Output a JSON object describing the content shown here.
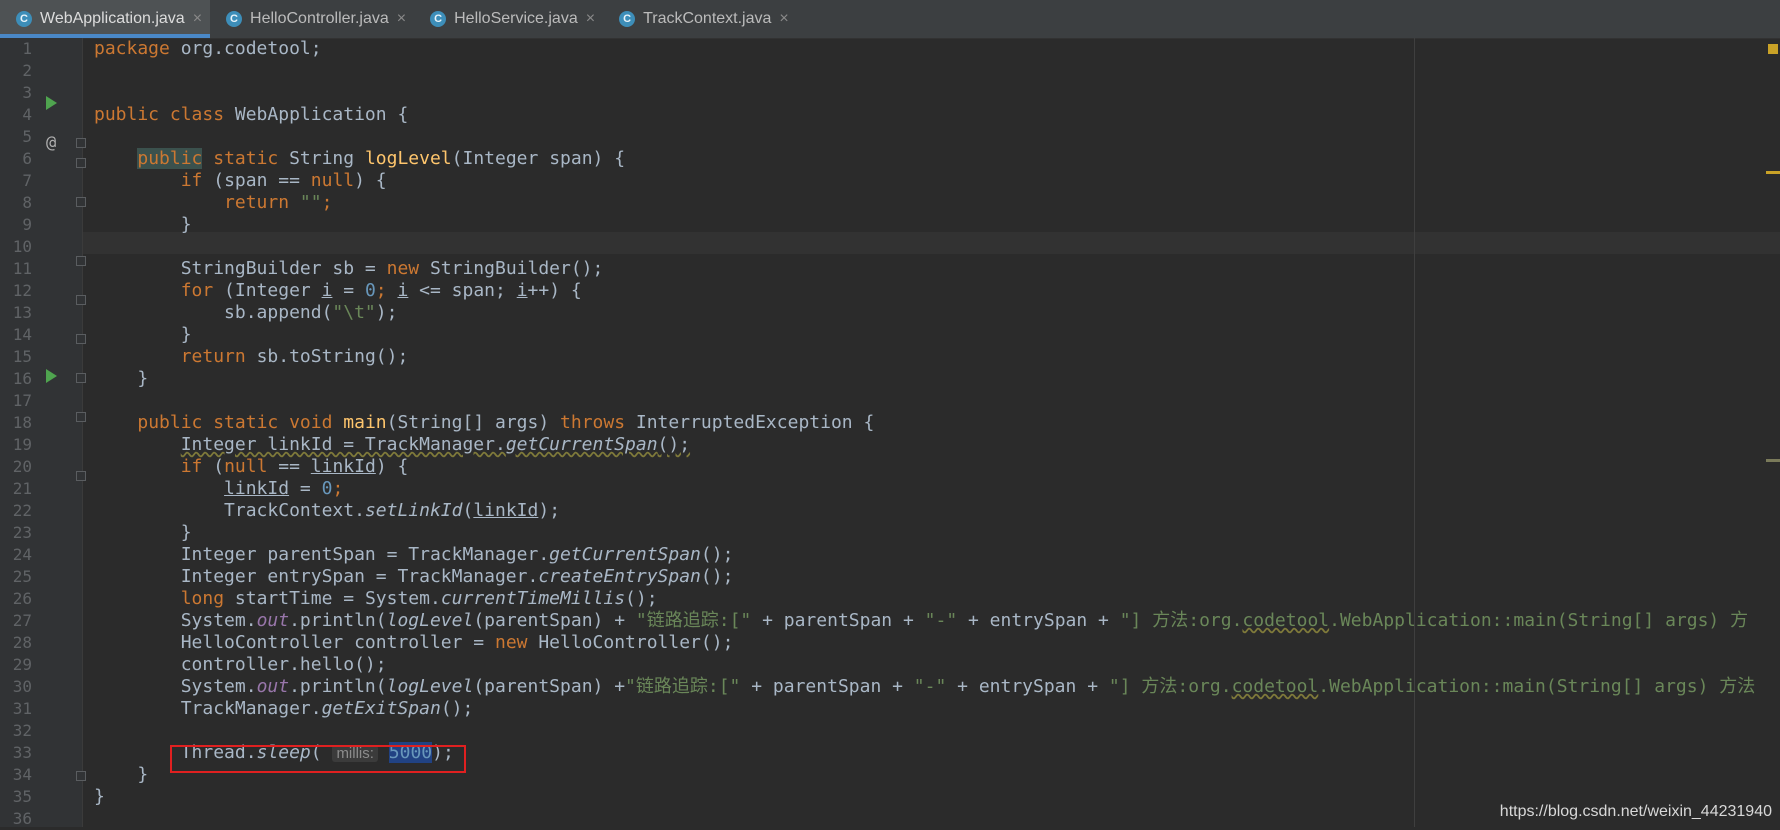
{
  "tabs": [
    {
      "label": "WebApplication.java",
      "active": true
    },
    {
      "label": "HelloController.java",
      "active": false
    },
    {
      "label": "HelloService.java",
      "active": false
    },
    {
      "label": "TrackContext.java",
      "active": false
    }
  ],
  "tab_icon_letter": "C",
  "tab_close_glyph": "×",
  "gutter_at_glyph": "@",
  "line_numbers": [
    "1",
    "2",
    "3",
    "4",
    "5",
    "6",
    "7",
    "8",
    "9",
    "10",
    "11",
    "12",
    "13",
    "14",
    "15",
    "16",
    "17",
    "18",
    "19",
    "20",
    "21",
    "22",
    "23",
    "24",
    "25",
    "26",
    "27",
    "28",
    "29",
    "30",
    "31",
    "32",
    "33",
    "34",
    "35",
    "36"
  ],
  "code": {
    "l1": {
      "kw": "package",
      "rest": " org.codetool;"
    },
    "l4": {
      "mod": "public class",
      "cls": " WebApplication {"
    },
    "l6": {
      "pub": "public",
      "kw": " static",
      "type": " String ",
      "fn": "logLevel",
      "rest": "(Integer span) {"
    },
    "l7": {
      "kw": "if",
      "a": " (span == ",
      "nul": "null",
      "b": ") {"
    },
    "l8": {
      "kw": "return",
      "str": "\"\"",
      "semi": ";"
    },
    "l9": "}",
    "l11": {
      "a": "StringBuilder sb = ",
      "kw": "new",
      "b": " StringBuilder();"
    },
    "l12": {
      "kw": "for",
      "a": " (Integer ",
      "v1": "i",
      "b": " = ",
      "n": "0",
      "c": "; ",
      "v2": "i",
      "d": " <= span; ",
      "v3": "i",
      "e": "++) {"
    },
    "l13": {
      "a": "sb.append(",
      "str": "\"\\t\"",
      "b": ");"
    },
    "l14": "}",
    "l15": {
      "kw": "return",
      "rest": " sb.toString();"
    },
    "l16": "}",
    "l18": {
      "kw": "public static void",
      "fn": " main",
      "a": "(String[] args) ",
      "thr": "throws",
      "b": " InterruptedException {"
    },
    "l19": {
      "a": "Integer linkId = TrackManager.",
      "m": "getCurrentSpan",
      "b": "();"
    },
    "l20": {
      "kw": "if",
      "a": " (",
      "nul": "null",
      "b": " == ",
      "v": "linkId",
      "c": ") {"
    },
    "l21": {
      "v": "linkId",
      "a": " = ",
      "n": "0",
      "b": ";"
    },
    "l22": {
      "a": "TrackContext.",
      "m": "setLinkId",
      "b": "(",
      "v": "linkId",
      "c": ");"
    },
    "l23": "}",
    "l24": {
      "a": "Integer parentSpan = TrackManager.",
      "m": "getCurrentSpan",
      "b": "();"
    },
    "l25": {
      "a": "Integer entrySpan = TrackManager.",
      "m": "createEntrySpan",
      "b": "();"
    },
    "l26": {
      "kw": "long",
      "a": " startTime = System.",
      "m": "currentTimeMillis",
      "b": "();"
    },
    "l27": {
      "a": "System.",
      "f": "out",
      "b": ".println(",
      "m": "logLevel",
      "c": "(parentSpan) + ",
      "s1": "\"链路追踪:[\"",
      "d": " + parentSpan + ",
      "s2": "\"-\"",
      "e": " + entrySpan + ",
      "s3a": "\"] 方法:org.",
      "s3u": "codetool",
      "s3b": ".WebApplication::main(String[] args) 方"
    },
    "l28": {
      "a": "HelloController controller = ",
      "kw": "new",
      "b": " HelloController();"
    },
    "l29": "controller.hello();",
    "l30": {
      "a": "System.",
      "f": "out",
      "b": ".println(",
      "m": "logLevel",
      "c": "(parentSpan) +",
      "s1": "\"链路追踪:[\"",
      "d": " + parentSpan + ",
      "s2": "\"-\"",
      "e": " + entrySpan + ",
      "s3a": "\"] 方法:org.",
      "s3u": "codetool",
      "s3b": ".WebApplication::main(String[] args) 方法"
    },
    "l31": {
      "a": "TrackManager.",
      "m": "getExitSpan",
      "b": "();"
    },
    "l33": {
      "a": "Thread.",
      "m": "sleep",
      "b": "( ",
      "hint": "millis:",
      "n": "5000",
      "c": ");"
    },
    "l34": "}",
    "l35": "}"
  },
  "watermark": "https://blog.csdn.net/weixin_44231940"
}
